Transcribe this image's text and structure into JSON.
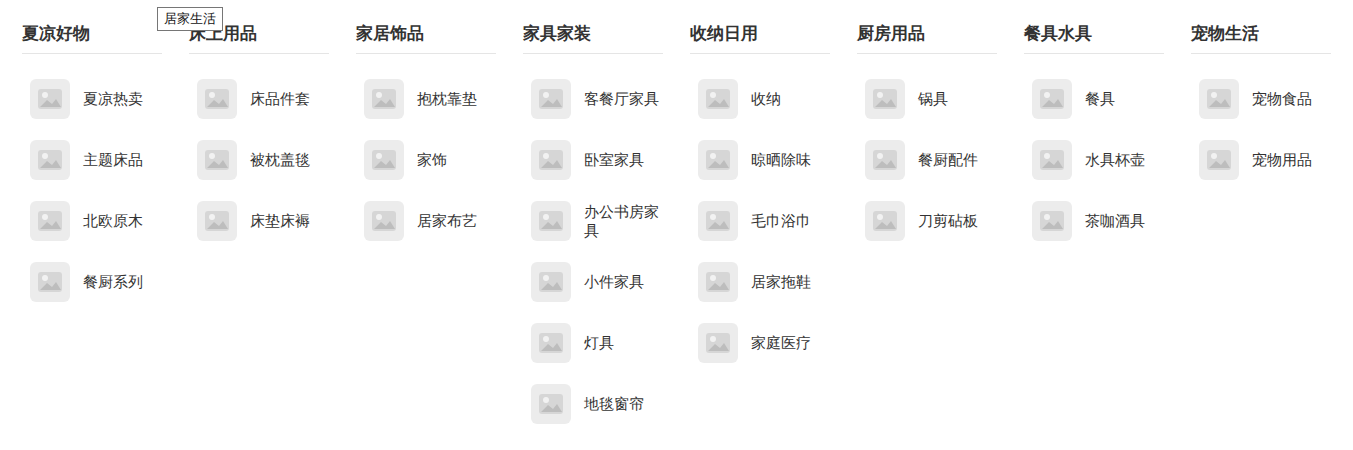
{
  "tooltip": "居家生活",
  "columns": [
    {
      "title": "夏凉好物",
      "items": [
        "夏凉热卖",
        "主题床品",
        "北欧原木",
        "餐厨系列"
      ]
    },
    {
      "title": "床上用品",
      "items": [
        "床品件套",
        "被枕盖毯",
        "床垫床褥"
      ]
    },
    {
      "title": "家居饰品",
      "items": [
        "抱枕靠垫",
        "家饰",
        "居家布艺"
      ]
    },
    {
      "title": "家具家装",
      "items": [
        "客餐厅家具",
        "卧室家具",
        "办公书房家具",
        "小件家具",
        "灯具",
        "地毯窗帘"
      ]
    },
    {
      "title": "收纳日用",
      "items": [
        "收纳",
        "晾晒除味",
        "毛巾浴巾",
        "居家拖鞋",
        "家庭医疗"
      ]
    },
    {
      "title": "厨房用品",
      "items": [
        "锅具",
        "餐厨配件",
        "刀剪砧板"
      ]
    },
    {
      "title": "餐具水具",
      "items": [
        "餐具",
        "水具杯壶",
        "茶咖酒具"
      ]
    },
    {
      "title": "宠物生活",
      "items": [
        "宠物食品",
        "宠物用品"
      ]
    }
  ]
}
